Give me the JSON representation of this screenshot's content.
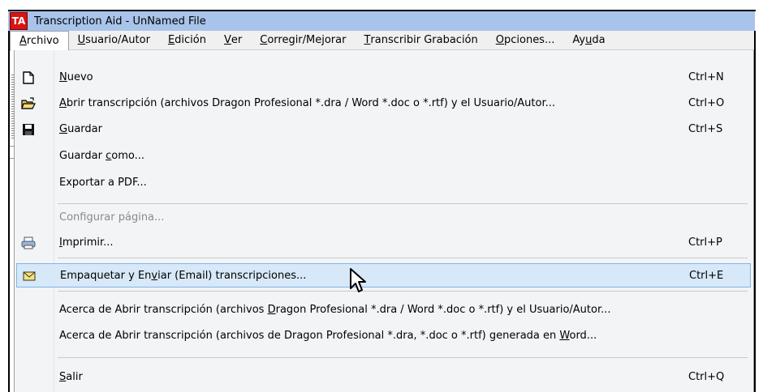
{
  "window": {
    "title": "Transcription Aid - UnNamed File",
    "app_icon_text": "TA"
  },
  "menubar": {
    "items": [
      {
        "pre": "",
        "ul": "A",
        "post": "rchivo"
      },
      {
        "pre": "",
        "ul": "U",
        "post": "suario/Autor"
      },
      {
        "pre": "",
        "ul": "E",
        "post": "dición"
      },
      {
        "pre": "",
        "ul": "V",
        "post": "er"
      },
      {
        "pre": "",
        "ul": "C",
        "post": "orregir/Mejorar"
      },
      {
        "pre": "",
        "ul": "T",
        "post": "ranscribir Grabación"
      },
      {
        "pre": "",
        "ul": "O",
        "post": "pciones..."
      },
      {
        "pre": "Ay",
        "ul": "u",
        "post": "da"
      }
    ]
  },
  "menu": {
    "items": [
      {
        "pre": "",
        "ul": "N",
        "post": "uevo",
        "shortcut": "Ctrl+N",
        "icon": "new-document-icon"
      },
      {
        "pre": "",
        "ul": "A",
        "post": "brir transcripción (archivos Dragon Profesional *.dra / Word *.doc o *.rtf) y el Usuario/Autor...",
        "shortcut": "Ctrl+O",
        "icon": "open-folder-icon"
      },
      {
        "pre": "",
        "ul": "G",
        "post": "uardar",
        "shortcut": "Ctrl+S",
        "icon": "save-disk-icon"
      },
      {
        "pre": "Guardar ",
        "ul": "c",
        "post": "omo...",
        "shortcut": "",
        "icon": ""
      },
      {
        "pre": "Exportar a PDF...",
        "ul": "",
        "post": "",
        "shortcut": "",
        "icon": ""
      },
      {
        "pre": "Configurar página...",
        "ul": "",
        "post": "",
        "shortcut": "",
        "icon": "",
        "disabled": true
      },
      {
        "pre": "",
        "ul": "I",
        "post": "mprimir...",
        "shortcut": "Ctrl+P",
        "icon": "printer-icon"
      },
      {
        "pre": "Empaquetar y En",
        "ul": "v",
        "post": "iar (Email) transcripciones...",
        "shortcut": "Ctrl+E",
        "icon": "envelope-icon",
        "hover": true
      },
      {
        "pre": "Acerca de Abrir transcripción (archivos ",
        "ul": "D",
        "post": "ragon Profesional *.dra / Word *.doc o *.rtf) y el Usuario/Autor...",
        "shortcut": "",
        "icon": ""
      },
      {
        "pre": "Acerca de Abrir transcripción (archivos de Dragon Profesional *.dra, *.doc o *.rtf) generada en ",
        "ul": "W",
        "post": "ord...",
        "shortcut": "",
        "icon": ""
      },
      {
        "pre": "",
        "ul": "S",
        "post": "alir",
        "shortcut": "Ctrl+Q",
        "icon": ""
      }
    ]
  }
}
